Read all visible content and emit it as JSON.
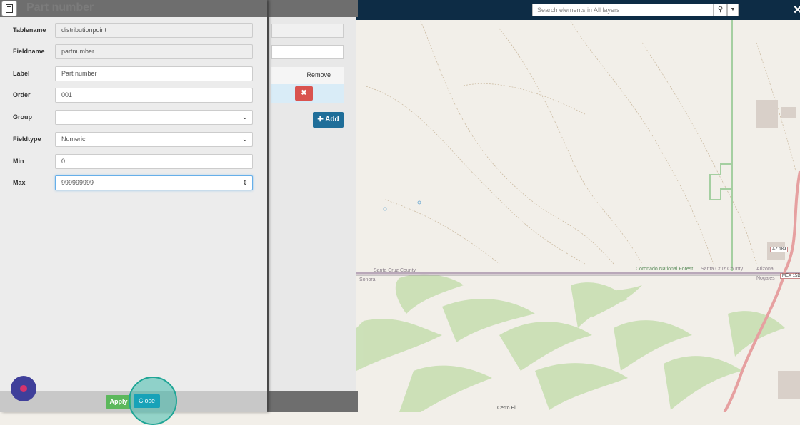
{
  "dialog": {
    "title": "Part number",
    "fields": [
      {
        "label": "Tablename",
        "value": "distributionpoint",
        "type": "readonly"
      },
      {
        "label": "Fieldname",
        "value": "partnumber",
        "type": "readonly"
      },
      {
        "label": "Label",
        "value": "Part number",
        "type": "text"
      },
      {
        "label": "Order",
        "value": "001",
        "type": "text"
      },
      {
        "label": "Group",
        "value": "",
        "type": "select"
      },
      {
        "label": "Fieldtype",
        "value": "Numeric",
        "type": "select"
      },
      {
        "label": "Min",
        "value": "0",
        "type": "text"
      },
      {
        "label": "Max",
        "value": "999999999",
        "type": "number"
      }
    ],
    "apply_label": "Apply",
    "close_label": "Close"
  },
  "mid_panel": {
    "remove_header": "Remove",
    "remove_icon": "close-icon",
    "add_label": "Add",
    "add_icon": "plus-icon"
  },
  "map": {
    "search_placeholder": "Search elements in All layers",
    "search_icon": "search-icon",
    "labels": {
      "santa_cruz_left": "Santa Cruz County",
      "sonora": "Sonora",
      "coronado": "Coronado National Forest",
      "santa_cruz_right": "Santa Cruz County",
      "arizona": "Arizona",
      "nogales": "Nogales",
      "az189": "AZ 189",
      "mex15": "MEX 15D",
      "cerro": "Cerro El"
    }
  },
  "colors": {
    "map_topbar": "#0d2c45",
    "apply": "#5cb85c",
    "close": "#17a2b8",
    "remove": "#d9534f",
    "add": "#1f6e99"
  }
}
